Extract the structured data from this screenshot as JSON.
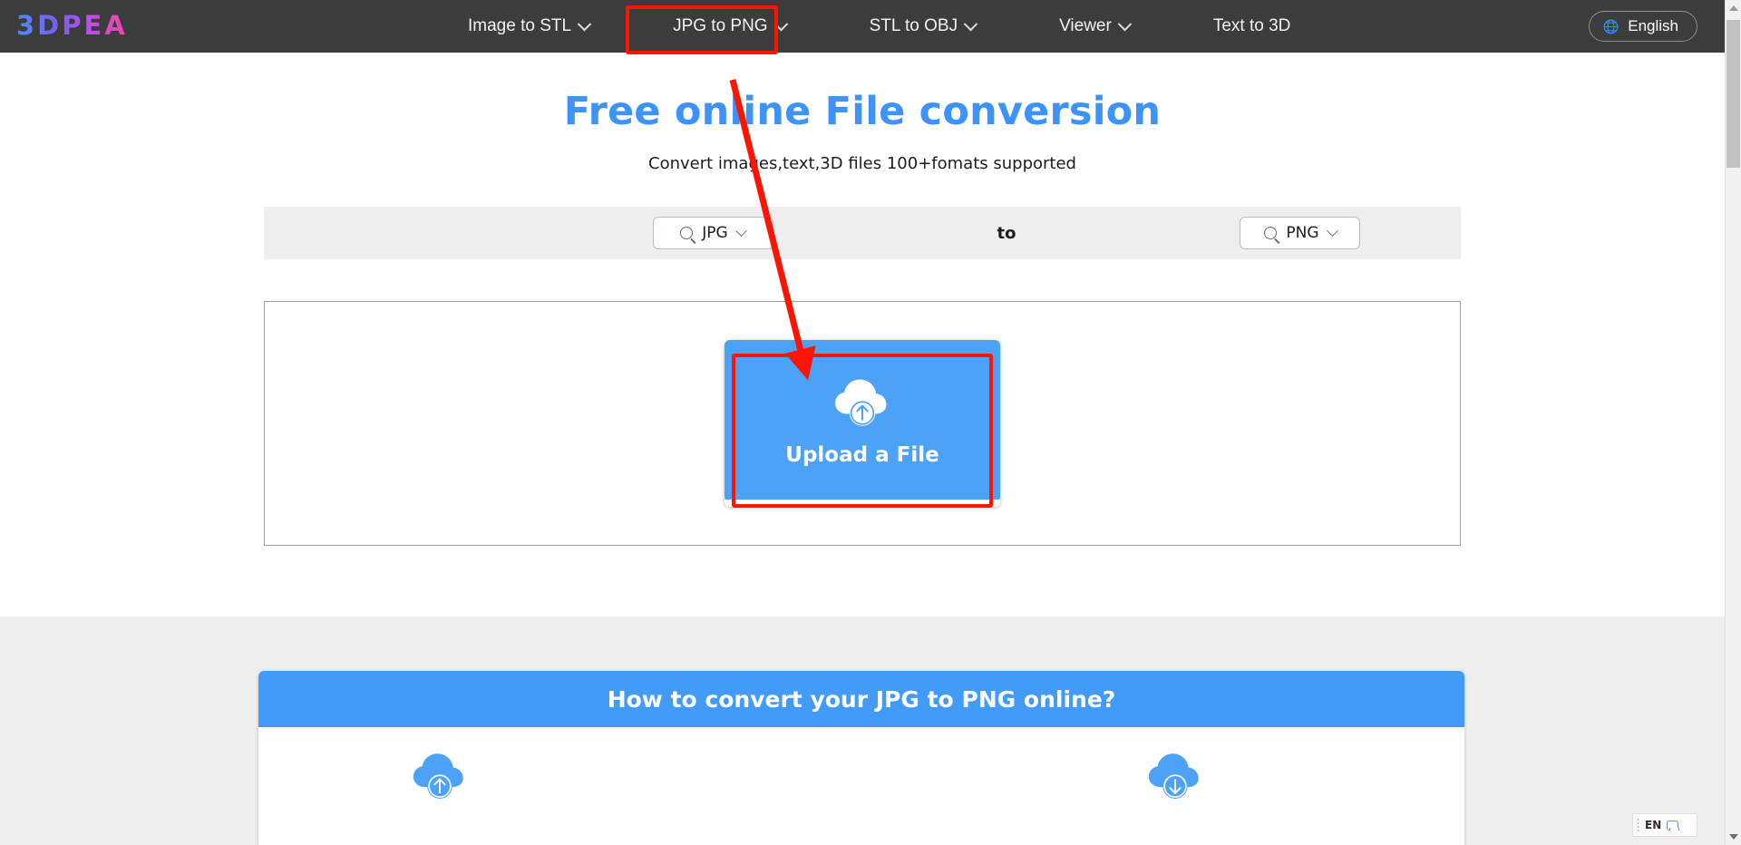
{
  "brand": {
    "logo_text": "3DPEA"
  },
  "nav": {
    "items": [
      {
        "label": "Image to STL",
        "has_dropdown": true,
        "active": false
      },
      {
        "label": "JPG to PNG",
        "has_dropdown": true,
        "active": true
      },
      {
        "label": "STL to OBJ",
        "has_dropdown": true,
        "active": false
      },
      {
        "label": "Viewer",
        "has_dropdown": true,
        "active": false
      },
      {
        "label": "Text to 3D",
        "has_dropdown": false,
        "active": false
      }
    ],
    "language": {
      "label": "English",
      "icon": "globe-icon"
    }
  },
  "hero": {
    "title": "Free online File conversion",
    "subtitle": "Convert images,text,3D files 100+fomats supported",
    "title_color": "#3d93f7"
  },
  "converter": {
    "source_format": "JPG",
    "target_format": "PNG",
    "connector": "to",
    "search_icon": "search-icon",
    "chevron_icon": "chevron-down-icon"
  },
  "upload": {
    "label": "Upload a File",
    "icon": "cloud-upload-icon",
    "button_color": "#4ca2f7"
  },
  "howto": {
    "title": "How to convert your JPG to PNG online?",
    "header_color": "#429bf7",
    "steps": [
      {
        "icon": "cloud-upload-icon"
      },
      {
        "icon": "cloud-download-icon"
      }
    ]
  },
  "annotations": {
    "highlight_color": "#fc1505",
    "nav_highlight_target": "JPG to PNG",
    "upload_highlight_target": "Upload a File",
    "arrow": "red-arrow-pointing-to-upload-button"
  },
  "scrollbar": {
    "up_icon": "scroll-up-arrow-icon",
    "down_icon": "scroll-down-arrow-icon"
  },
  "ime": {
    "language": "EN",
    "mode_icon": "ime-mode-icon"
  }
}
